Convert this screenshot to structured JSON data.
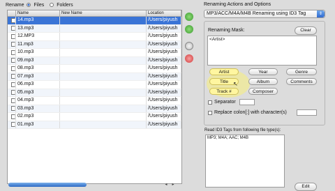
{
  "rename": {
    "label": "Rename",
    "files_label": "Files",
    "folders_label": "Folders"
  },
  "table": {
    "headers": [
      "Name",
      "New Name",
      "Location"
    ],
    "rows": [
      {
        "name": "14.mp3",
        "new": "",
        "loc": "/Users/piyush"
      },
      {
        "name": "13.mp3",
        "new": "",
        "loc": "/Users/piyush"
      },
      {
        "name": "12.MP3",
        "new": "",
        "loc": "/Users/piyush"
      },
      {
        "name": "11.mp3",
        "new": "",
        "loc": "/Users/piyush"
      },
      {
        "name": "10.mp3",
        "new": "",
        "loc": "/Users/piyush"
      },
      {
        "name": "09.mp3",
        "new": "",
        "loc": "/Users/piyush"
      },
      {
        "name": "08.mp3",
        "new": "",
        "loc": "/Users/piyush"
      },
      {
        "name": "07.mp3",
        "new": "",
        "loc": "/Users/piyush"
      },
      {
        "name": "06.mp3",
        "new": "",
        "loc": "/Users/piyush"
      },
      {
        "name": "05.mp3",
        "new": "",
        "loc": "/Users/piyush"
      },
      {
        "name": "04.mp3",
        "new": "",
        "loc": "/Users/piyush"
      },
      {
        "name": "03.mp3",
        "new": "",
        "loc": "/Users/piyush"
      },
      {
        "name": "02.mp3",
        "new": "",
        "loc": "/Users/piyush"
      },
      {
        "name": "01.mp3",
        "new": "",
        "loc": "/Users/piyush"
      }
    ]
  },
  "right": {
    "title": "Renaming Actions and Options",
    "mode": "MP3/ACC/M4A/M4B Renaming using ID3 Tag",
    "mask_label": "Renaming Mask:",
    "clear": "Clear",
    "mask_value": "<Artist>",
    "tags": [
      "Artist",
      "Year",
      "Genre",
      "Title",
      "Album",
      "Comments",
      "Track #",
      "Composer"
    ],
    "separator": "Separator",
    "replace": "Replace colon[:] with character(s)",
    "read_label": "Read ID3 Tags from following file type(s):",
    "file_types": "MP3; M4A; AAC; M4B",
    "edit": "Edit"
  },
  "colors": {
    "accent": "#3a74d6",
    "highlight": "#fff6a0"
  }
}
